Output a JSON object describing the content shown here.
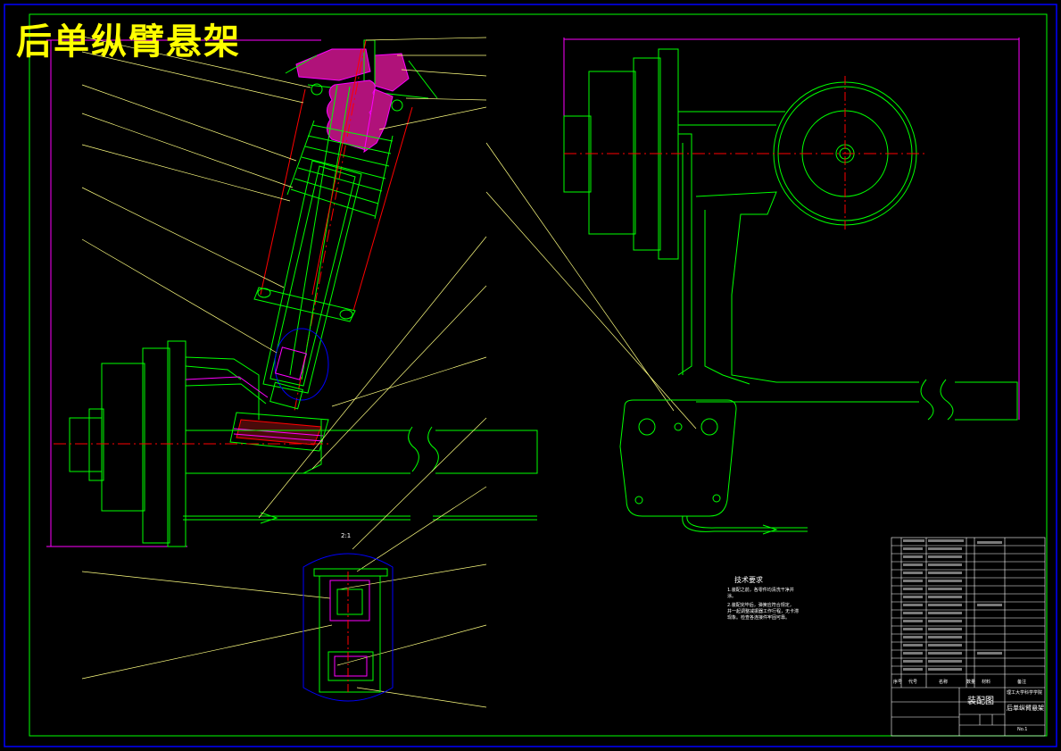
{
  "drawing": {
    "title": "后单纵臂悬架",
    "detail_view_label": "2:1",
    "technical_requirements": {
      "heading": "技术要求",
      "lines": [
        "1.装配之前，各零件均清洗干净并",
        "涂。",
        "2.装配完毕后，弹簧应符合规定，",
        "并一起调整减振器工作行程，无卡滞",
        "现象。检查各连接件牢固可靠。"
      ]
    },
    "title_block": {
      "drawing_type": "装配图",
      "school": "理工大学科学学院",
      "name": "后单纵臂悬架",
      "header_cells": [
        "序号",
        "代号",
        "名称",
        "数量",
        "材料",
        "备注"
      ],
      "drawing_no": "No.1"
    },
    "colors": {
      "background": "#000000",
      "outline": "#00ff00",
      "dimension": "#ff00ff",
      "leader": "#ffff80",
      "section": "#ff0000",
      "detail": "#0000ff",
      "hatch": "#ff00ff",
      "title": "#ffff00",
      "text": "#ffffff"
    }
  }
}
